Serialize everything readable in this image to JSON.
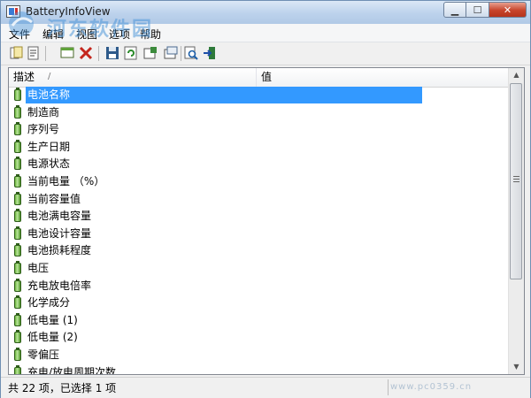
{
  "window": {
    "title": "BatteryInfoView"
  },
  "watermark": {
    "text": "河东软件园",
    "url": "www.pc0359.cn"
  },
  "menu": {
    "items": [
      "文件",
      "编辑",
      "视图",
      "选项",
      "帮助"
    ]
  },
  "toolbar": {
    "buttons": [
      "copy-icon",
      "properties-icon",
      "html-report-icon",
      "delete-icon",
      "save-icon",
      "refresh-icon",
      "log-icon",
      "export-icon",
      "search-icon",
      "exit-icon"
    ]
  },
  "list": {
    "columns": [
      "描述",
      "值"
    ],
    "sort_indicator": "/",
    "rows": [
      "电池名称",
      "制造商",
      "序列号",
      "生产日期",
      "电源状态",
      "当前电量 （%）",
      "当前容量值",
      "电池满电容量",
      "电池设计容量",
      "电池损耗程度",
      "电压",
      "充电放电倍率",
      "化学成分",
      "低电量 (1)",
      "低电量 (2)",
      "零偏压",
      "充电/放电周期次数"
    ],
    "selected_index": 0
  },
  "status": {
    "text": "共 22 项，已选择 1 项"
  },
  "colors": {
    "selection": "#3399ff",
    "battery": "#4b9424",
    "close_button": "#c7432a"
  }
}
